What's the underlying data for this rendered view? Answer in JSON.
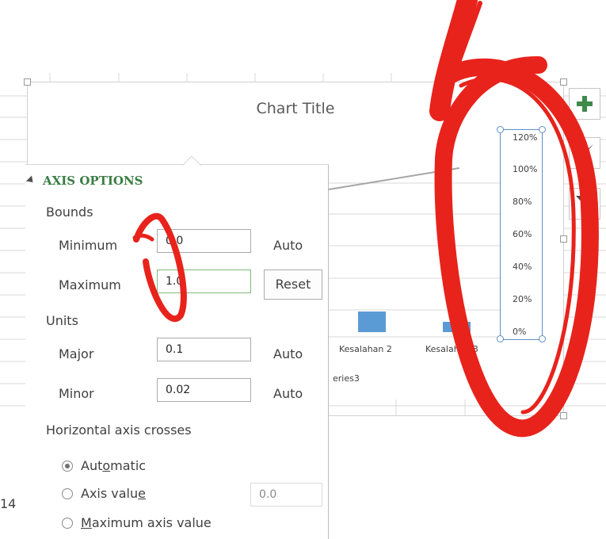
{
  "chart": {
    "title": "Chart Title",
    "axis_ticks": [
      "120%",
      "100%",
      "80%",
      "60%",
      "40%",
      "20%",
      "0%"
    ],
    "categories": [
      "Kesalahan 2",
      "Kesalahan 3"
    ],
    "legend_fragment": "eries3",
    "series_color": "#5b9bd5",
    "line_color": "#a6a6a6"
  },
  "toolbar": {
    "chart_elements": "plus-icon",
    "chart_styles": "brush-icon",
    "chart_filters": "filter-icon"
  },
  "pane": {
    "section_title": "AXIS OPTIONS",
    "bounds_label": "Bounds",
    "minimum_label": "Minimum",
    "minimum_value": "0.0",
    "minimum_state": "Auto",
    "maximum_label": "Maximum",
    "maximum_value": "1.0",
    "maximum_reset": "Reset",
    "units_label": "Units",
    "major_label": "Major",
    "major_value": "0.1",
    "major_state": "Auto",
    "minor_label": "Minor",
    "minor_value": "0.02",
    "minor_state": "Auto",
    "crosses_label": "Horizontal axis crosses",
    "crosses_options": {
      "automatic": {
        "pre": "Aut",
        "key": "o",
        "post": "matic",
        "selected": true
      },
      "axis_value": {
        "pre": "Axis valu",
        "key": "e",
        "post": "",
        "selected": false,
        "value": "0.0"
      },
      "maximum": {
        "pre": "",
        "key": "M",
        "post": "aximum axis value",
        "selected": false
      }
    },
    "accent": "#3a7d44"
  },
  "row_number": "14",
  "annotation_color": "#e8231c"
}
